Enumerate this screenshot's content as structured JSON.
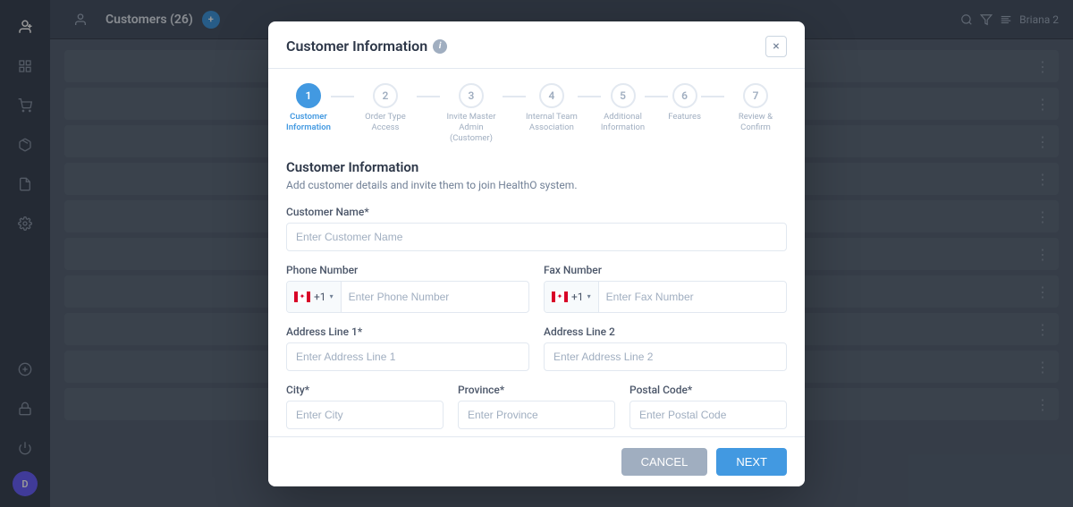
{
  "app": {
    "title": "Customers (26)",
    "badge": "26",
    "user": "Briana 2"
  },
  "sidebar": {
    "icons": [
      "user-plus",
      "grid",
      "shopping-cart",
      "package",
      "file",
      "settings",
      "user",
      "plus-circle",
      "lock",
      "power"
    ],
    "avatar_label": "D"
  },
  "modal": {
    "title": "Customer Information",
    "close_label": "×",
    "steps": [
      {
        "number": "1",
        "label": "Customer\nInformation",
        "active": true
      },
      {
        "number": "2",
        "label": "Order Type Access",
        "active": false
      },
      {
        "number": "3",
        "label": "Invite Master Admin (Customer)",
        "active": false
      },
      {
        "number": "4",
        "label": "Internal Team Association",
        "active": false
      },
      {
        "number": "5",
        "label": "Additional Information",
        "active": false
      },
      {
        "number": "6",
        "label": "Features",
        "active": false
      },
      {
        "number": "7",
        "label": "Review & Confirm",
        "active": false
      }
    ],
    "section_title": "Customer Information",
    "section_subtitle": "Add customer details and invite them to join HealthO system.",
    "fields": {
      "customer_name_label": "Customer Name*",
      "customer_name_placeholder": "Enter Customer Name",
      "phone_label": "Phone Number",
      "phone_placeholder": "Enter Phone Number",
      "phone_prefix": "+1",
      "fax_label": "Fax Number",
      "fax_placeholder": "Enter Fax Number",
      "fax_prefix": "+1",
      "address1_label": "Address Line 1*",
      "address1_placeholder": "Enter Address Line 1",
      "address2_label": "Address Line 2",
      "address2_placeholder": "Enter Address Line 2",
      "city_label": "City*",
      "city_placeholder": "Enter City",
      "province_label": "Province*",
      "province_placeholder": "Enter Province",
      "postal_label": "Postal Code*",
      "postal_placeholder": "Enter Postal Code"
    },
    "footer": {
      "cancel_label": "CANCEL",
      "next_label": "NEXT"
    }
  }
}
